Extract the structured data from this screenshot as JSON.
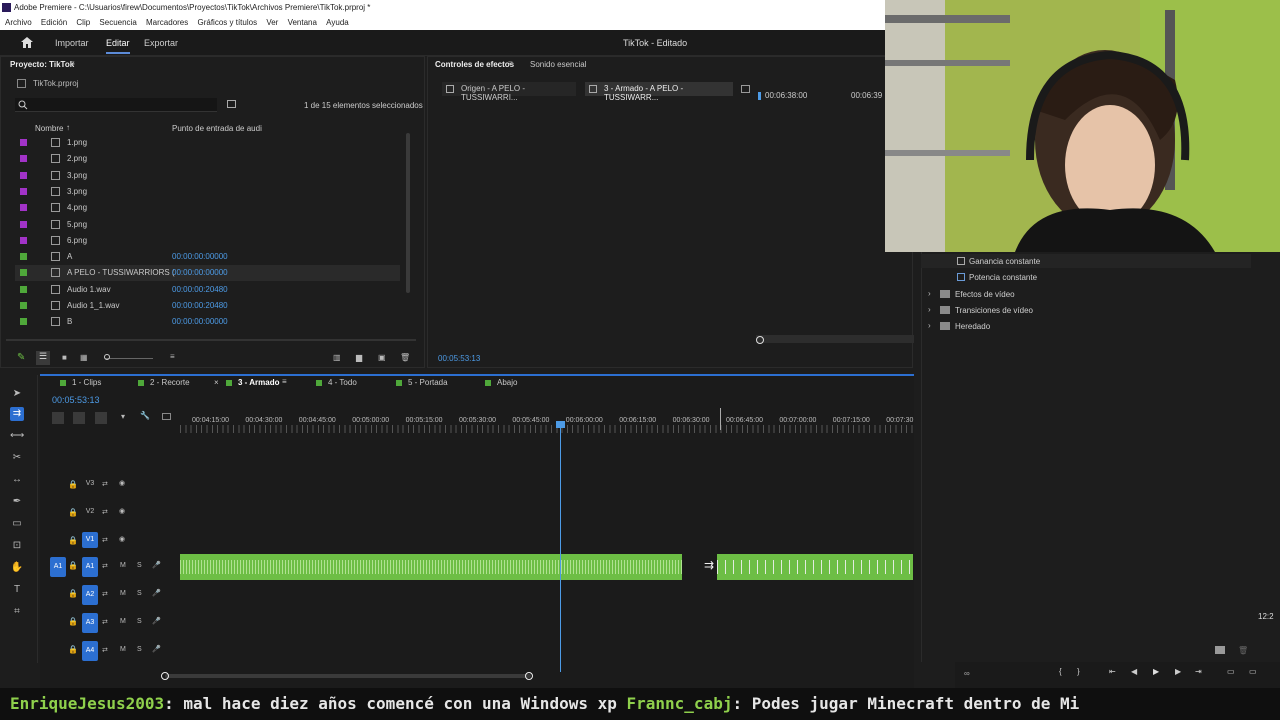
{
  "window": {
    "title": "Adobe Premiere - C:\\Usuarios\\firew\\Documentos\\Proyectos\\TikTok\\Archivos Premiere\\TikTok.prproj *"
  },
  "menu": [
    "Archivo",
    "Edición",
    "Clip",
    "Secuencia",
    "Marcadores",
    "Gráficos y títulos",
    "Ver",
    "Ventana",
    "Ayuda"
  ],
  "topnav": {
    "import": "Importar",
    "edit": "Editar",
    "export": "Exportar",
    "project_title": "TikTok - Editado"
  },
  "project_panel": {
    "tab": "Proyecto: TikTok",
    "file": "TikTok.prproj",
    "count": "1 de 15 elementos seleccionados",
    "col_name": "Nombre",
    "col_in": "Punto de entrada de audi",
    "items": [
      {
        "name": "1.png",
        "tc": "",
        "color": "#a233c8"
      },
      {
        "name": "2.png",
        "tc": "",
        "color": "#a233c8"
      },
      {
        "name": "3.png",
        "tc": "",
        "color": "#a233c8"
      },
      {
        "name": "3.png",
        "tc": "",
        "color": "#a233c8"
      },
      {
        "name": "4.png",
        "tc": "",
        "color": "#a233c8"
      },
      {
        "name": "5.png",
        "tc": "",
        "color": "#a233c8"
      },
      {
        "name": "6.png",
        "tc": "",
        "color": "#a233c8"
      },
      {
        "name": "A",
        "tc": "00:00:00:00000",
        "color": "#4fa83a"
      },
      {
        "name": "A PELO - TUSSIWARRIORS (",
        "tc": "00:00:00:00000",
        "color": "#4fa83a"
      },
      {
        "name": "Audio 1.wav",
        "tc": "00:00:00:20480",
        "color": "#4fa83a"
      },
      {
        "name": "Audio 1_1.wav",
        "tc": "00:00:00:20480",
        "color": "#4fa83a"
      },
      {
        "name": "B",
        "tc": "00:00:00:00000",
        "color": "#4fa83a"
      }
    ]
  },
  "effects_controls": {
    "tab1": "Controles de efectos",
    "tab2": "Sonido esencial",
    "source": "Origen - A PELO - TUSSIWARRI...",
    "sequence": "3 - Armado - A PELO - TUSSIWARR...",
    "tc1": "00:06:38:00",
    "tc2": "00:06:39",
    "current_tc": "00:05:53:13"
  },
  "effects_panel": {
    "items": [
      "Ganancia constante",
      "Potencia constante"
    ],
    "folders": [
      "Efectos de vídeo",
      "Transiciones de vídeo",
      "Heredado"
    ]
  },
  "timeline": {
    "tabs": [
      "1 - Clips",
      "2 - Recorte",
      "3 - Armado",
      "4 - Todo",
      "5 - Portada",
      "Abajo"
    ],
    "active_tab": "3 - Armado",
    "timecode": "00:05:53:13",
    "ruler": [
      "00:04:15:00",
      "00:04:30:00",
      "00:04:45:00",
      "00:05:00:00",
      "00:05:15:00",
      "00:05:30:00",
      "00:05:45:00",
      "00:06:00:00",
      "00:06:15:00",
      "00:06:30:00",
      "00:06:45:00",
      "00:07:00:00",
      "00:07:15:00",
      "00:07:30"
    ],
    "video_tracks": [
      "V3",
      "V2",
      "V1"
    ],
    "audio_tracks": [
      "A1",
      "A2",
      "A3",
      "A4"
    ],
    "source_patch": "A1",
    "track_m": "M",
    "track_s": "S"
  },
  "monitor": {
    "clock": "12:2"
  },
  "chat": {
    "user1": "EnriqueJesus2003",
    "msg1": ": mal hace diez años comencé con una Windows xp ",
    "user2": "Frannc_cabj",
    "msg2": ": Podes jugar Minecraft dentro de Mi"
  },
  "colors": {
    "accent": "#2c6fd1",
    "timecode": "#4d9be6",
    "audio_clip": "#6dbe45",
    "playhead": "#4d9be6"
  }
}
